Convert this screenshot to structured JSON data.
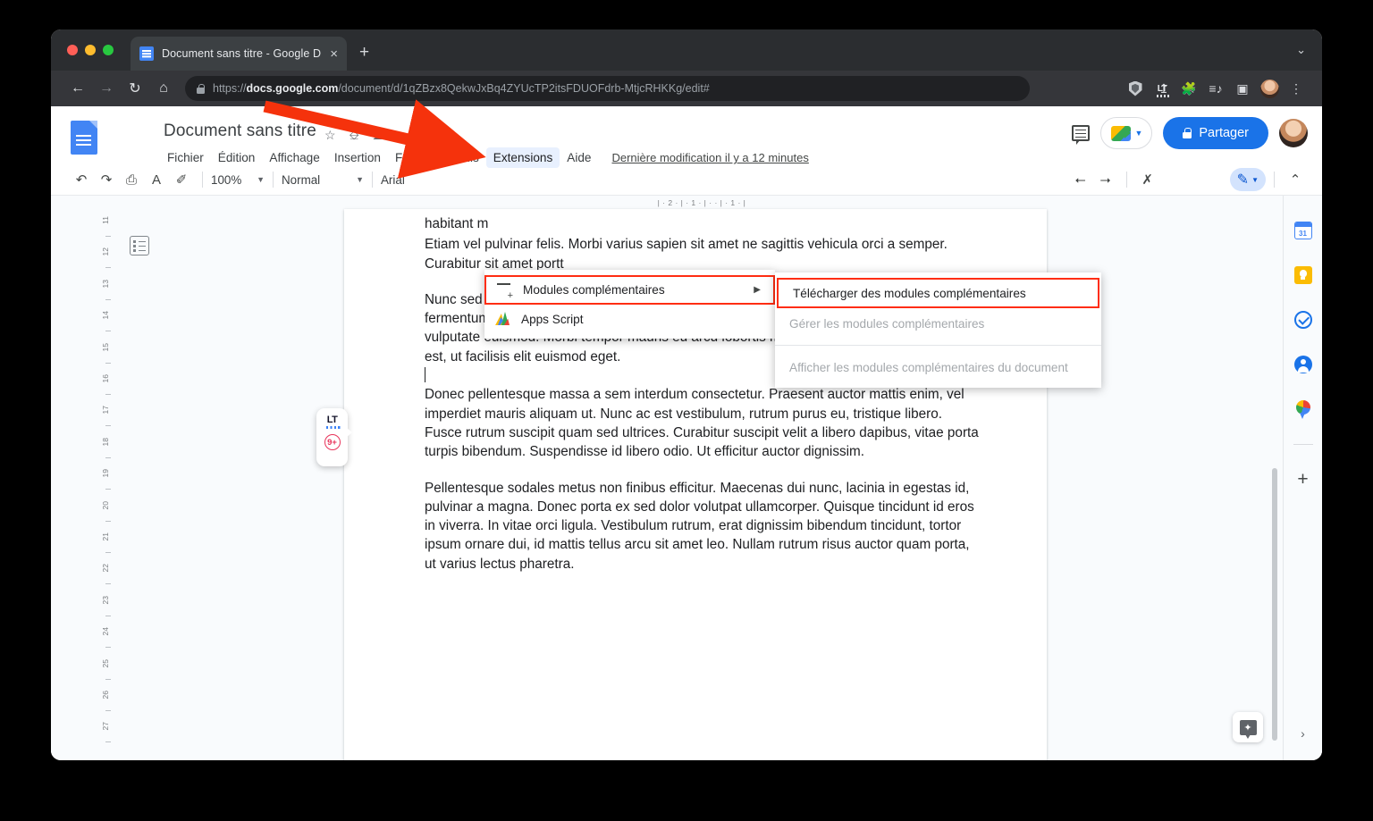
{
  "browser": {
    "tab": {
      "title": "Document sans titre - Google D",
      "close": "×"
    },
    "new_tab": "+",
    "window_chevron": "⌄",
    "nav": {
      "back": "←",
      "forward": "→",
      "reload": "↻",
      "home": "⌂"
    },
    "url": {
      "scheme": "https://",
      "domain": "docs.google.com",
      "path": "/document/d/1qZBzx8QekwJxBq4ZYUcTP2itsFDUOFdrb-MtjcRHKKg/edit#"
    },
    "omnibox_icons": [
      "download-icon",
      "share-icon",
      "bookmark-star-icon"
    ],
    "extension_icons": [
      "ublock-shield-icon",
      "languagetool-icon",
      "puzzle-extensions-icon",
      "reading-list-icon",
      "side-panel-icon",
      "profile-avatar",
      "chrome-menu-icon"
    ],
    "lt_label": "LT",
    "menu_dots": "⋮"
  },
  "docs": {
    "title": "Document sans titre",
    "title_icons": [
      "star-icon",
      "move-to-folder-icon",
      "cloud-saved-icon"
    ],
    "menus": [
      "Fichier",
      "Édition",
      "Affichage",
      "Insertion",
      "Format",
      "Outils",
      "Extensions",
      "Aide"
    ],
    "active_menu": "Extensions",
    "last_modified": "Dernière modification il y a 12 minutes",
    "share_label": "Partager",
    "toolbar": {
      "undo": "↶",
      "redo": "↷",
      "print": "⎙",
      "spellcheck": "A",
      "paint_format": "✐",
      "zoom": "100%",
      "style": "Normal",
      "font": "Arial",
      "caret": "▾",
      "indent_decrease": "⭠",
      "indent_increase": "⭢",
      "clear_format": "✗",
      "edit_mode": "✎",
      "collapse": "⌃"
    }
  },
  "extensions_menu": {
    "items": [
      {
        "label": "Modules complémentaires",
        "icon": "addon-icon",
        "has_submenu": true,
        "highlighted": true,
        "arrow": "▶"
      },
      {
        "label": "Apps Script",
        "icon": "apps-script-icon",
        "has_submenu": false,
        "highlighted": false
      }
    ]
  },
  "addons_submenu": {
    "items": [
      {
        "label": "Télécharger des modules complémentaires",
        "disabled": false,
        "highlighted": true
      },
      {
        "label": "Gérer les modules complémentaires",
        "disabled": true,
        "highlighted": false
      },
      {
        "label": "Afficher les modules complémentaires du document",
        "disabled": true,
        "highlighted": false
      }
    ]
  },
  "document": {
    "paragraphs": [
      "habitant m",
      "Etiam vel pulvinar felis. Morbi varius sapien sit amet ne sagittis vehicula orci a semper. Curabitur sit amet portt",
      "Nunc sed velit eu lorem ornare pretium eu non massa. Integer a accumsan enim. Nunc fermentum non nulla in dapibus. Curabitur quis feugiat elit. Nulla semper tellus sed vulputate euismod. Morbi tempor mauris eu arcu lobortis maximus. Nam semper semper est, ut facilisis elit euismod eget.",
      "Donec pellentesque massa a sem interdum consectetur. Praesent auctor mattis enim, vel imperdiet mauris aliquam ut. Nunc ac est vestibulum, rutrum purus eu, tristique libero. Fusce rutrum suscipit quam sed ultrices. Curabitur suscipit velit a libero dapibus, vitae porta turpis bibendum. Suspendisse id libero odio. Ut efficitur auctor dignissim.",
      "Pellentesque sodales metus non finibus efficitur. Maecenas dui nunc, lacinia in egestas id, pulvinar a magna. Donec porta ex sed dolor volutpat ullamcorper. Quisque tincidunt id eros in viverra. In vitae orci ligula. Vestibulum rutrum, erat dignissim bibendum tincidunt, tortor ipsum ornare dui, id mattis tellus arcu sit amet leo. Nullam rutrum risus auctor quam porta, ut varius lectus pharetra."
    ],
    "h_ruler": "|  ·  2  ·  |  ·  1  ·  |  ·    ·  |  ·  1  ·  |",
    "v_ruler_numbers": [
      "11",
      "12",
      "13",
      "14",
      "15",
      "16",
      "17",
      "18",
      "19",
      "20",
      "21",
      "22",
      "23",
      "24",
      "25",
      "26",
      "27"
    ]
  },
  "languagetool_widget": {
    "logo": "LT",
    "badge": "9+"
  },
  "right_rail": {
    "items": [
      "calendar-icon",
      "keep-icon",
      "tasks-icon",
      "contacts-icon",
      "maps-icon"
    ],
    "calendar_day": "31",
    "add": "+",
    "expand": "›"
  },
  "explore_button": {
    "icon": "explore-spark-icon",
    "glyph": "✦"
  },
  "colors": {
    "accent_blue": "#1a73e8",
    "highlight_red": "#ff2d12",
    "menu_highlight": "#e8f0fe",
    "chrome_dark": "#2b2d30",
    "badge_red": "#e8335a"
  }
}
